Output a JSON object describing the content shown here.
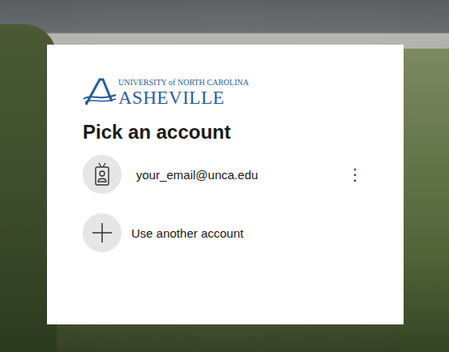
{
  "logo": {
    "line1": "UNIVERSITY of NORTH CAROLINA",
    "line2": "ASHEVILLE"
  },
  "title": "Pick an account",
  "accounts": [
    {
      "email": "your_email@unca.edu",
      "menu": "⋮"
    }
  ],
  "add_account": {
    "label": "Use another account"
  }
}
